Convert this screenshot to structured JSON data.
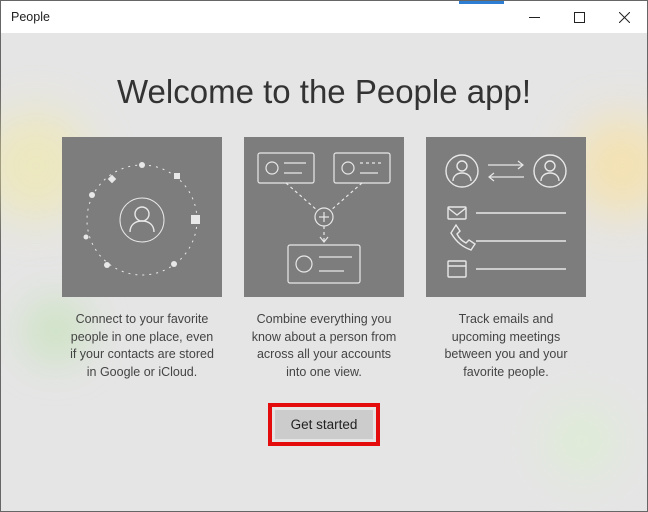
{
  "window": {
    "title": "People"
  },
  "heading": "Welcome to the People app!",
  "cards": [
    {
      "caption": "Connect to your favorite people in one place, even if your contacts are stored in Google or iCloud."
    },
    {
      "caption": "Combine everything you know about a person from across all your accounts into one view."
    },
    {
      "caption": "Track emails and upcoming meetings between you and your favorite people."
    }
  ],
  "cta_label": "Get started"
}
